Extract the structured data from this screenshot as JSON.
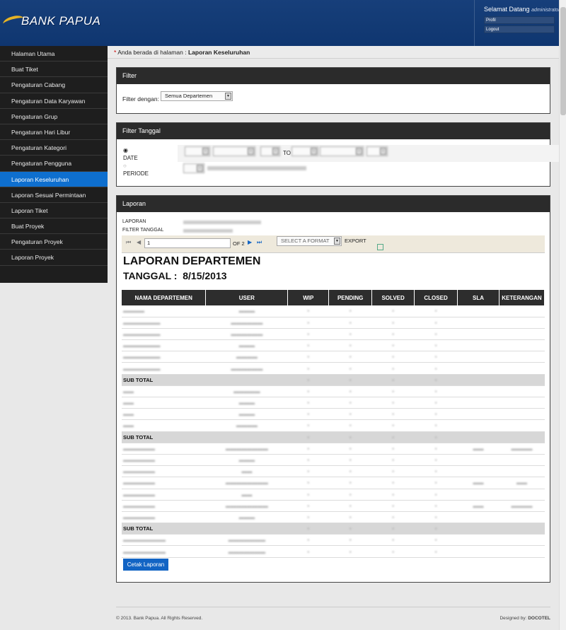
{
  "header": {
    "brand": "BANK PAPUA",
    "greeting": "Selamat Datang",
    "username": "administrator",
    "profile_label": "Profil",
    "logout_label": "Logout"
  },
  "sidebar": {
    "items": [
      {
        "label": "Halaman Utama"
      },
      {
        "label": "Buat Tiket"
      },
      {
        "label": "Pengaturan Cabang"
      },
      {
        "label": "Pengaturan Data Karyawan"
      },
      {
        "label": "Pengaturan Grup"
      },
      {
        "label": "Pengaturan Hari Libur"
      },
      {
        "label": "Pengaturan Kategori"
      },
      {
        "label": "Pengaturan Pengguna"
      },
      {
        "label": "Laporan Keseluruhan"
      },
      {
        "label": "Laporan Sesuai Permintaan"
      },
      {
        "label": "Laporan Tiket"
      },
      {
        "label": "Buat Proyek"
      },
      {
        "label": "Pengaturan Proyek"
      },
      {
        "label": "Laporan Proyek"
      }
    ],
    "active_index": 8
  },
  "breadcrumb": {
    "prefix": "Anda berada di halaman :",
    "current": "Laporan Keseluruhan"
  },
  "filter": {
    "title": "Filter",
    "label": "Filter dengan:",
    "value": "Semua Departemen"
  },
  "filter_date": {
    "title": "Filter Tanggal",
    "date_label": "DATE",
    "period_label": "PERIODE",
    "to_label": "TO"
  },
  "report": {
    "title": "Laporan",
    "laporan_label": "LAPORAN",
    "filter_tanggal_label": "FILTER TANGGAL",
    "page_input": "1",
    "of_pages": "OF 2",
    "format_placeholder": "SELECT A FORMAT",
    "export_label": "EXPORT",
    "heading": "LAPORAN DEPARTEMEN",
    "date_heading": "TANGGAL :  8/15/2013",
    "columns": [
      "NAMA DEPARTEMEN",
      "USER",
      "WIP",
      "PENDING",
      "SOLVED",
      "CLOSED",
      "SLA",
      "KETERANGAN"
    ],
    "subtotal_label": "SUB TOTAL",
    "print_button": "Cetak Laporan"
  },
  "footer": {
    "copyright": "© 2013. Bank Papua. All Rights Reserved.",
    "designed_by": "Designed by:",
    "designer": "DOCOTEL"
  },
  "colors": {
    "header_bg": "#173f7a",
    "active_nav": "#0e6fcf",
    "button": "#1264c4"
  }
}
